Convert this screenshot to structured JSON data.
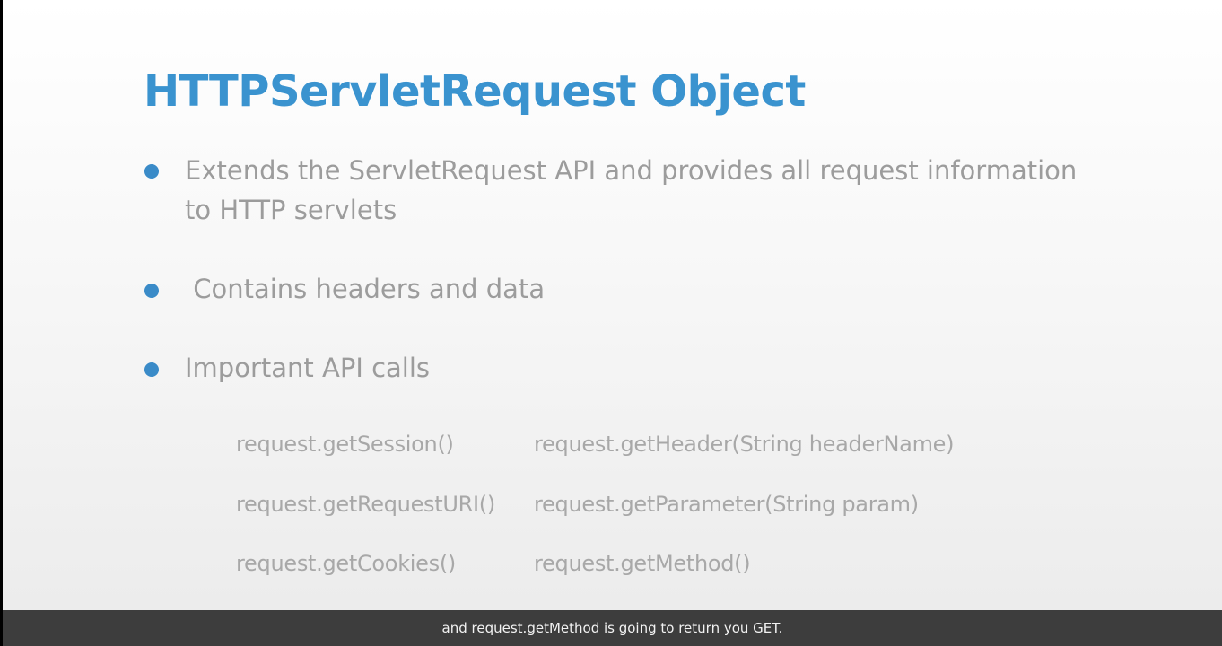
{
  "slide": {
    "title": "HTTPServletRequest Object",
    "bullets": [
      {
        "line1": "Extends the ServletRequest API and provides all request information",
        "line2": "to HTTP servlets"
      },
      {
        "line1": " Contains headers and data"
      },
      {
        "line1": "Important API calls"
      }
    ],
    "api_calls": {
      "left": [
        "request.getSession()",
        "request.getRequestURI()",
        "request.getCookies()"
      ],
      "right": [
        "request.getHeader(String headerName)",
        "request.getParameter(String param)",
        "request.getMethod()"
      ]
    }
  },
  "caption": {
    "text": "and request.getMethod is going to return you GET."
  },
  "colors": {
    "title": "#3a93cf",
    "bullet_dot": "#3a8bc8",
    "body_text": "#9c9c9c",
    "caption_bg": "#3d3d3d"
  }
}
